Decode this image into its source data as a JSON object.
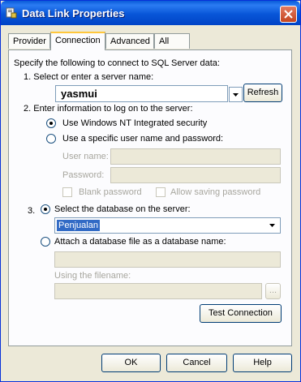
{
  "window": {
    "title": "Data Link Properties"
  },
  "tabs": [
    {
      "label": "Provider"
    },
    {
      "label": "Connection"
    },
    {
      "label": "Advanced"
    },
    {
      "label": "All"
    }
  ],
  "connection": {
    "intro": "Specify the following to connect to SQL Server data:",
    "step1_label": "1. Select or enter a server name:",
    "server_name": "yasmui",
    "refresh_label": "Refresh",
    "step2_label": "2. Enter information to log on to the server:",
    "nt_security_label": "Use Windows NT Integrated security",
    "specific_user_label": "Use a specific user name and password:",
    "username_label": "User name:",
    "password_label": "Password:",
    "blank_password_label": "Blank password",
    "allow_saving_label": "Allow saving password",
    "step3_number": "3.",
    "select_db_label": "Select the database on the server:",
    "database": "Penjualan",
    "attach_label": "Attach a database file as a database name:",
    "using_filename_label": "Using the filename:",
    "browse_label": "...",
    "test_connection_label": "Test Connection"
  },
  "footer": {
    "ok_label": "OK",
    "cancel_label": "Cancel",
    "help_label": "Help"
  }
}
